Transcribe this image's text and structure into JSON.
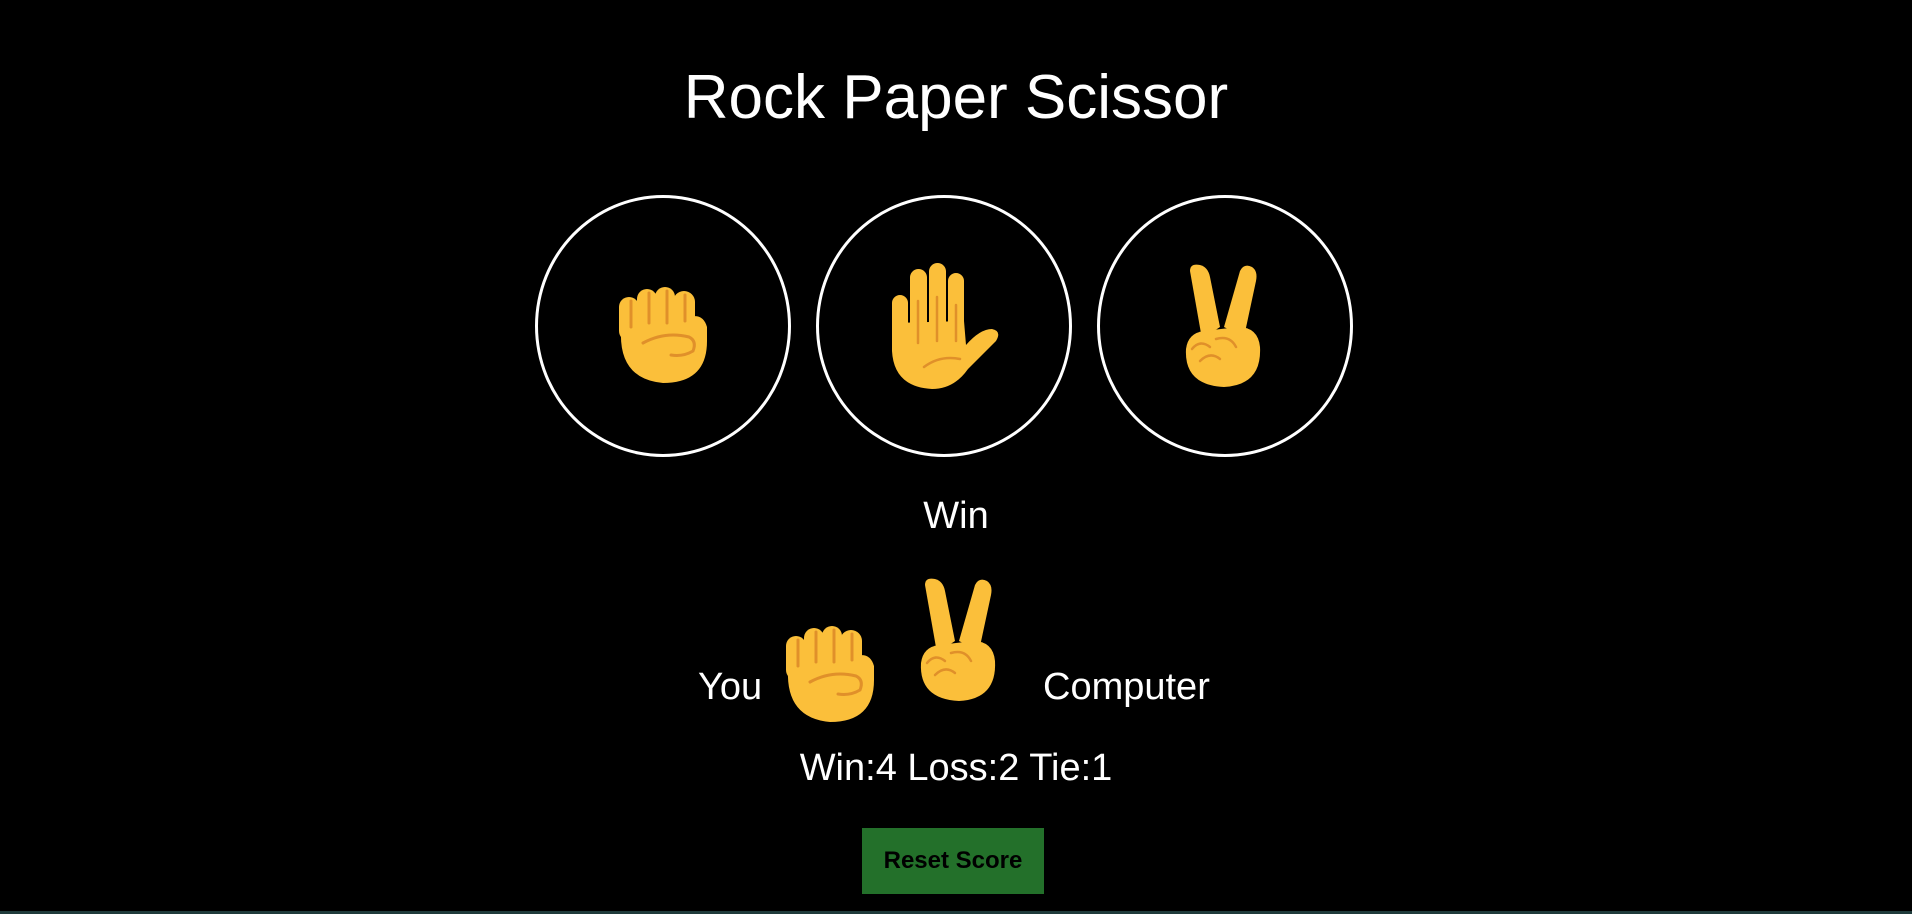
{
  "title": "Rock Paper Scissor",
  "choices": [
    {
      "name": "rock",
      "icon": "raised-fist-icon"
    },
    {
      "name": "paper",
      "icon": "raised-hand-icon"
    },
    {
      "name": "scissors",
      "icon": "victory-hand-icon"
    }
  ],
  "result": "Win",
  "round": {
    "you_label": "You",
    "computer_label": "Computer",
    "player_move": "rock",
    "computer_move": "scissors"
  },
  "score": {
    "win_label": "Win:",
    "win": "4",
    "loss_label": "Loss:",
    "loss": "2",
    "tie_label": "Tie:",
    "tie": "1"
  },
  "reset_label": "Reset Score",
  "colors": {
    "background": "#000000",
    "text": "#ffffff",
    "emoji_yellow": "#fbbf3a",
    "emoji_shade": "#e0902a",
    "reset_button": "#23702a"
  }
}
